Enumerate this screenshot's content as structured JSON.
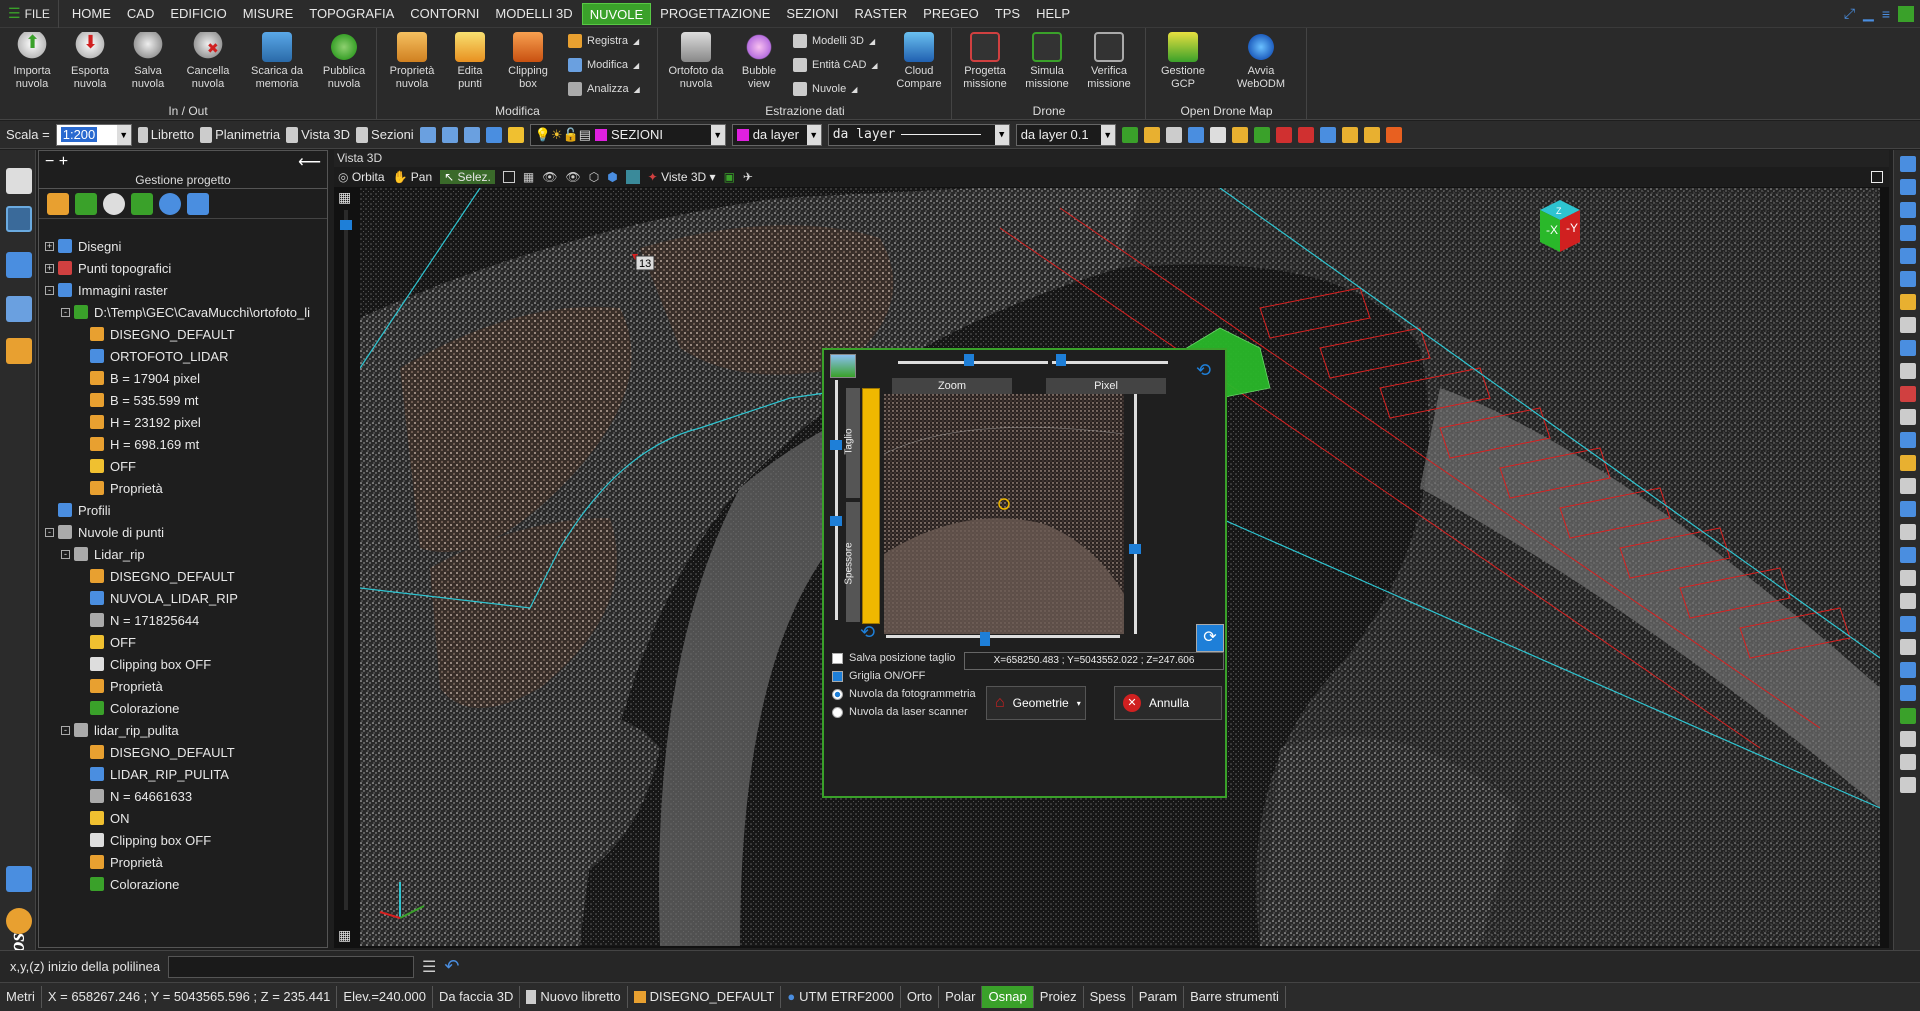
{
  "menu": {
    "file_label": "FILE",
    "items": [
      "HOME",
      "CAD",
      "EDIFICIO",
      "MISURE",
      "TOPOGRAFIA",
      "CONTORNI",
      "MODELLI 3D",
      "NUVOLE",
      "PROGETTAZIONE",
      "SEZIONI",
      "RASTER",
      "PREGEO",
      "TPS",
      "HELP"
    ],
    "active": "NUVOLE"
  },
  "ribbon": {
    "groups": [
      {
        "title": "In / Out",
        "buttons": [
          "Importa\nnuvola",
          "Esporta\nnuvola",
          "Salva\nnuvola",
          "Cancella\nnuvola",
          "Scarica da\nmemoria",
          "Pubblica\nnuvola"
        ]
      },
      {
        "title": "Modifica",
        "buttons": [
          "Proprietà\nnuvola",
          "Edita\npunti",
          "Clipping\nbox"
        ],
        "small": [
          "Registra",
          "Modifica",
          "Analizza"
        ]
      },
      {
        "title": "Estrazione dati",
        "buttons": [
          "Ortofoto da\nnuvola",
          "Bubble\nview"
        ],
        "small": [
          "Modelli 3D",
          "Entità CAD",
          "Nuvole"
        ],
        "extra": [
          "Cloud\nCompare"
        ]
      },
      {
        "title": "Drone",
        "buttons": [
          "Progetta\nmissione",
          "Simula\nmissione",
          "Verifica\nmissione"
        ]
      },
      {
        "title": "Open Drone Map",
        "buttons": [
          "Gestione\nGCP",
          "Avvia\nWebODM"
        ]
      }
    ]
  },
  "toolbar": {
    "scale_label": "Scala =",
    "scale_value": "1:200",
    "libretto": "Libretto",
    "planimetria": "Planimetria",
    "vista3d": "Vista 3D",
    "sezioni": "Sezioni",
    "layer_name": "SEZIONI",
    "color_combo": "da layer",
    "linetype_combo": "da layer",
    "lineweight_combo": "da layer 0.1"
  },
  "panel": {
    "title": "Gestione progetto",
    "tree": [
      {
        "level": 0,
        "exp": "+",
        "label": "Disegni",
        "icon": "drawings-icon"
      },
      {
        "level": 0,
        "exp": "+",
        "label": "Punti topografici",
        "icon": "topo-points-icon"
      },
      {
        "level": 0,
        "exp": "-",
        "label": "Immagini raster",
        "icon": "raster-icon"
      },
      {
        "level": 1,
        "exp": "-",
        "label": "D:\\Temp\\GEC\\CavaMucchi\\ortofoto_li",
        "icon": "raster-file-icon"
      },
      {
        "level": 2,
        "exp": "",
        "label": "DISEGNO_DEFAULT",
        "icon": "drawing-icon"
      },
      {
        "level": 2,
        "exp": "",
        "label": "ORTOFOTO_LIDAR",
        "icon": "layer-icon"
      },
      {
        "level": 2,
        "exp": "",
        "label": "B = 17904 pixel",
        "icon": "dimension-icon"
      },
      {
        "level": 2,
        "exp": "",
        "label": "B = 535.599 mt",
        "icon": "dimension-icon"
      },
      {
        "level": 2,
        "exp": "",
        "label": "H = 23192 pixel",
        "icon": "dimension-icon"
      },
      {
        "level": 2,
        "exp": "",
        "label": "H = 698.169 mt",
        "icon": "dimension-icon"
      },
      {
        "level": 2,
        "exp": "",
        "label": "OFF",
        "icon": "lamp-icon"
      },
      {
        "level": 2,
        "exp": "",
        "label": "Proprietà",
        "icon": "properties-icon"
      },
      {
        "level": 0,
        "exp": "",
        "label": "Profili",
        "icon": "profiles-icon"
      },
      {
        "level": 0,
        "exp": "-",
        "label": "Nuvole di punti",
        "icon": "cloud-icon"
      },
      {
        "level": 1,
        "exp": "-",
        "label": "Lidar_rip",
        "icon": "cloud-icon"
      },
      {
        "level": 2,
        "exp": "",
        "label": "DISEGNO_DEFAULT",
        "icon": "drawing-icon"
      },
      {
        "level": 2,
        "exp": "",
        "label": "NUVOLA_LIDAR_RIP",
        "icon": "layer-icon"
      },
      {
        "level": 2,
        "exp": "",
        "label": "N = 171825644",
        "icon": "count-icon"
      },
      {
        "level": 2,
        "exp": "",
        "label": "OFF",
        "icon": "lamp-icon"
      },
      {
        "level": 2,
        "exp": "",
        "label": "Clipping box OFF",
        "icon": "clipping-box-icon"
      },
      {
        "level": 2,
        "exp": "",
        "label": "Proprietà",
        "icon": "properties-icon"
      },
      {
        "level": 2,
        "exp": "",
        "label": "Colorazione",
        "icon": "coloring-icon"
      },
      {
        "level": 1,
        "exp": "-",
        "label": "lidar_rip_pulita",
        "icon": "cloud-icon"
      },
      {
        "level": 2,
        "exp": "",
        "label": "DISEGNO_DEFAULT",
        "icon": "drawing-icon"
      },
      {
        "level": 2,
        "exp": "",
        "label": "LIDAR_RIP_PULITA",
        "icon": "layer-icon"
      },
      {
        "level": 2,
        "exp": "",
        "label": "N = 64661633",
        "icon": "count-icon"
      },
      {
        "level": 2,
        "exp": "",
        "label": "ON",
        "icon": "lamp-icon"
      },
      {
        "level": 2,
        "exp": "",
        "label": "Clipping box OFF",
        "icon": "clipping-box-icon"
      },
      {
        "level": 2,
        "exp": "",
        "label": "Proprietà",
        "icon": "properties-icon"
      },
      {
        "level": 2,
        "exp": "",
        "label": "Colorazione",
        "icon": "coloring-icon"
      }
    ]
  },
  "view3d": {
    "title": "Vista 3D",
    "tools": {
      "orbit": "Orbita",
      "pan": "Pan",
      "select": "Selez.",
      "views": "Viste 3D"
    },
    "marker": "13"
  },
  "dialog": {
    "zoom_label": "Zoom",
    "pixel_label": "Pixel",
    "taglio_label": "Taglio",
    "spessore_label": "Spessore",
    "coords": "X=658250.483 ; Y=5043552.022 ; Z=247.606",
    "save_cut": "Salva posizione taglio",
    "grid": "Griglia ON/OFF",
    "photo_cloud": "Nuvola da fotogrammetria",
    "laser_cloud": "Nuvola da laser scanner",
    "geometries_button": "Geometrie",
    "cancel_button": "Annulla"
  },
  "command": {
    "prompt": "x,y,(z) inizio della polilinea"
  },
  "status": {
    "units": "Metri",
    "coords": "X = 658267.246 ; Y = 5043565.596 ; Z = 235.441",
    "elev": "Elev.=240.000",
    "face": "Da faccia 3D",
    "libretto": "Nuovo libretto",
    "drawing": "DISEGNO_DEFAULT",
    "crs": "UTM ETRF2000",
    "toggles": [
      "Orto",
      "Polar",
      "Osnap",
      "Proiez",
      "Spess",
      "Param",
      "Barre strumenti"
    ],
    "active_toggle": "Osnap"
  },
  "colors": {
    "accent": "#3aa12a",
    "highlight_yellow": "#f0b800",
    "slider_blue": "#1e7fd8",
    "cyan_line": "#2ec4d0",
    "red_line": "#d82020"
  }
}
